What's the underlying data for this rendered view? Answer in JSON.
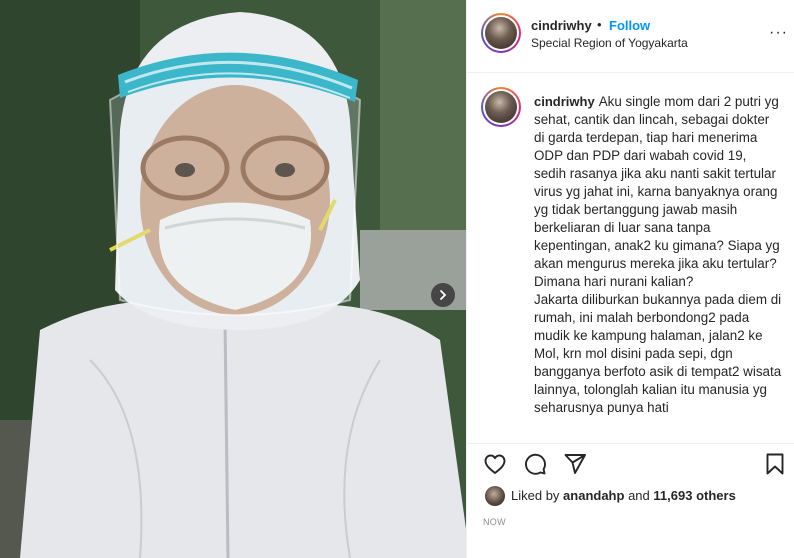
{
  "post": {
    "username": "cindriwhy",
    "separator": "•",
    "follow_label": "Follow",
    "location": "Special Region of Yogyakarta",
    "more_label": "···"
  },
  "caption": {
    "username": "cindriwhy",
    "text": "Aku single mom dari 2 putri yg sehat, cantik dan lincah, sebagai dokter di garda terdepan, tiap hari menerima ODP dan PDP dari wabah covid 19, sedih rasanya jika aku nanti sakit tertular virus yg jahat ini, karna banyaknya orang yg tidak bertanggung jawab masih berkeliaran di luar sana tanpa kepentingan, anak2 ku gimana? Siapa yg akan mengurus mereka jika aku tertular? Dimana hari nurani kalian?\nJakarta diliburkan bukannya pada diem di rumah, ini malah berbondong2 pada mudik ke kampung halaman, jalan2 ke Mol, krn mol disini pada sepi, dgn bangganya berfoto asik di tempat2 wisata lainnya, tolonglah kalian itu manusia yg seharusnya punya hati"
  },
  "likes": {
    "prefix": "Liked by",
    "user": "anandahp",
    "connector": "and",
    "count": "11,693 others"
  },
  "timestamp": "NOW",
  "icons": {
    "like": "heart-icon",
    "comment": "comment-icon",
    "share": "paper-plane-icon",
    "save": "bookmark-icon",
    "next": "chevron-right-icon"
  },
  "colors": {
    "accent": "#0095f6",
    "text": "#262626",
    "muted": "#8e8e8e",
    "border": "#efefef"
  }
}
